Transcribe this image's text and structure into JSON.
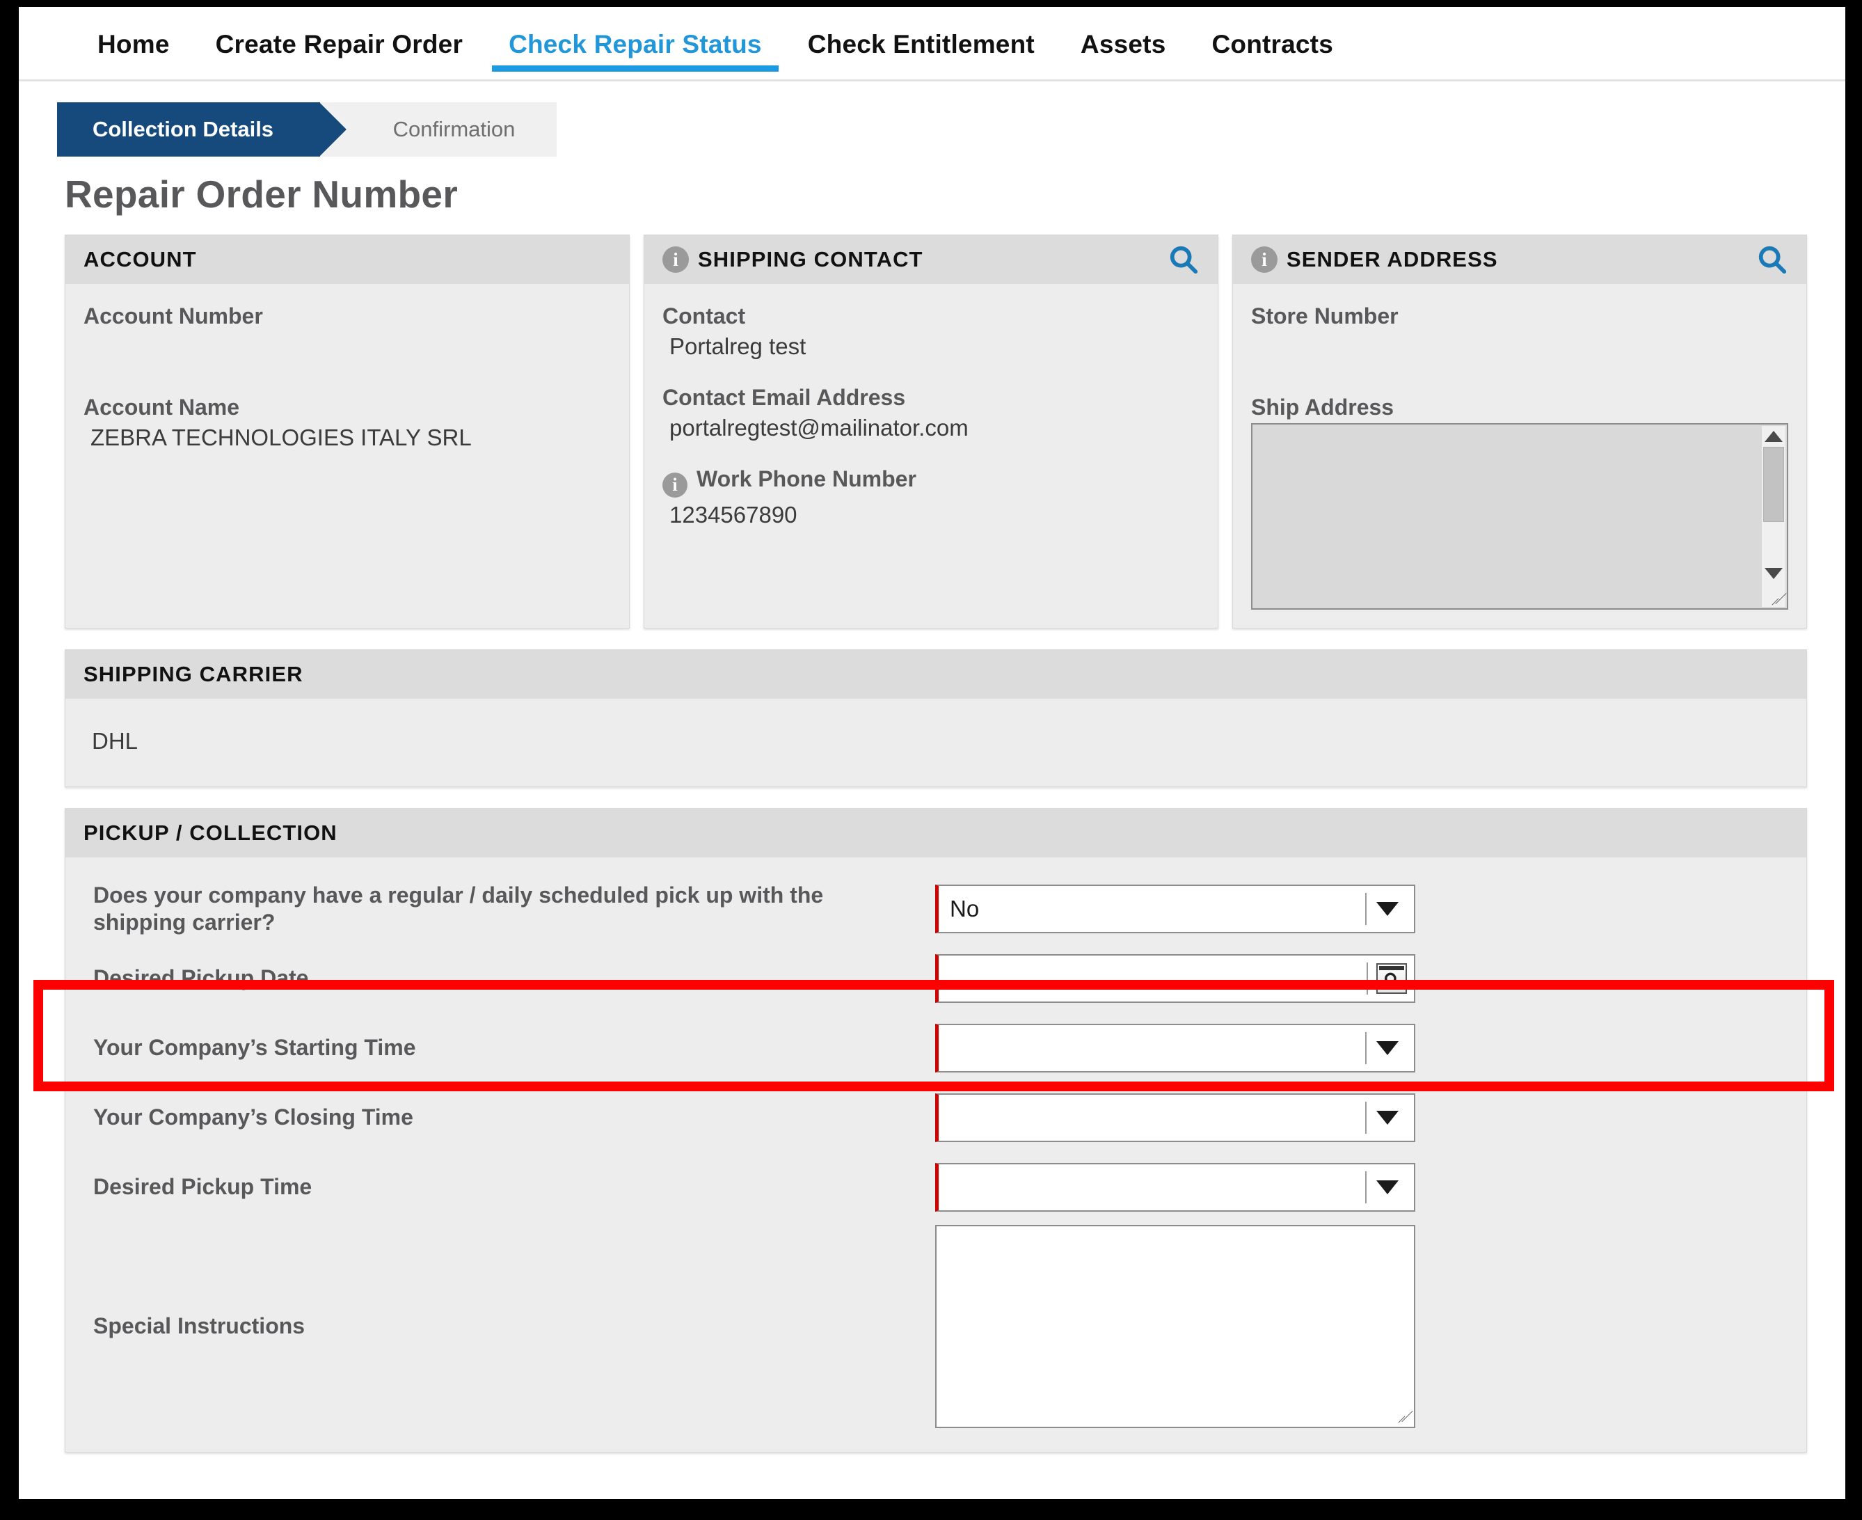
{
  "nav": {
    "items": [
      {
        "label": "Home",
        "active": false
      },
      {
        "label": "Create Repair Order",
        "active": false
      },
      {
        "label": "Check Repair Status",
        "active": true
      },
      {
        "label": "Check Entitlement",
        "active": false
      },
      {
        "label": "Assets",
        "active": false
      },
      {
        "label": "Contracts",
        "active": false
      }
    ]
  },
  "steps": {
    "current": "Collection Details",
    "next": "Confirmation"
  },
  "page": {
    "title": "Repair Order Number"
  },
  "account": {
    "heading": "ACCOUNT",
    "number_label": "Account Number",
    "number_value": "",
    "name_label": "Account Name",
    "name_value": "ZEBRA TECHNOLOGIES ITALY SRL"
  },
  "shipping_contact": {
    "heading": "SHIPPING CONTACT",
    "info_icon": "info-icon",
    "search_icon": "search-icon",
    "contact_label": "Contact",
    "contact_value": "Portalreg test",
    "email_label": "Contact Email Address",
    "email_value": "portalregtest@mailinator.com",
    "phone_label": "Work Phone Number",
    "phone_value": "1234567890"
  },
  "sender_address": {
    "heading": "SENDER ADDRESS",
    "info_icon": "info-icon",
    "search_icon": "search-icon",
    "store_label": "Store Number",
    "store_value": "",
    "ship_label": "Ship Address",
    "ship_value": ""
  },
  "shipping_carrier": {
    "heading": "SHIPPING CARRIER",
    "value": "DHL"
  },
  "pickup": {
    "heading": "PICKUP / COLLECTION",
    "scheduled_label": "Does your company have a regular / daily scheduled pick up with the shipping carrier?",
    "scheduled_value": "No",
    "pickup_date_label": "Desired Pickup Date",
    "pickup_date_value": "",
    "starting_time_label": "Your Company’s Starting Time",
    "starting_time_value": "",
    "closing_time_label": "Your Company’s Closing Time",
    "closing_time_value": "",
    "pickup_time_label": "Desired Pickup Time",
    "pickup_time_value": "",
    "special_label": "Special Instructions",
    "special_value": ""
  },
  "annotation": {
    "color": "#ff0000",
    "target": "Desired Pickup Date"
  },
  "colors": {
    "accent_blue": "#1b9ae0",
    "step_navy": "#164a7d",
    "required_red": "#d00000",
    "panel_header_gray": "#dcdcdc",
    "panel_body_gray": "#ededed",
    "label_gray": "#58585a"
  }
}
